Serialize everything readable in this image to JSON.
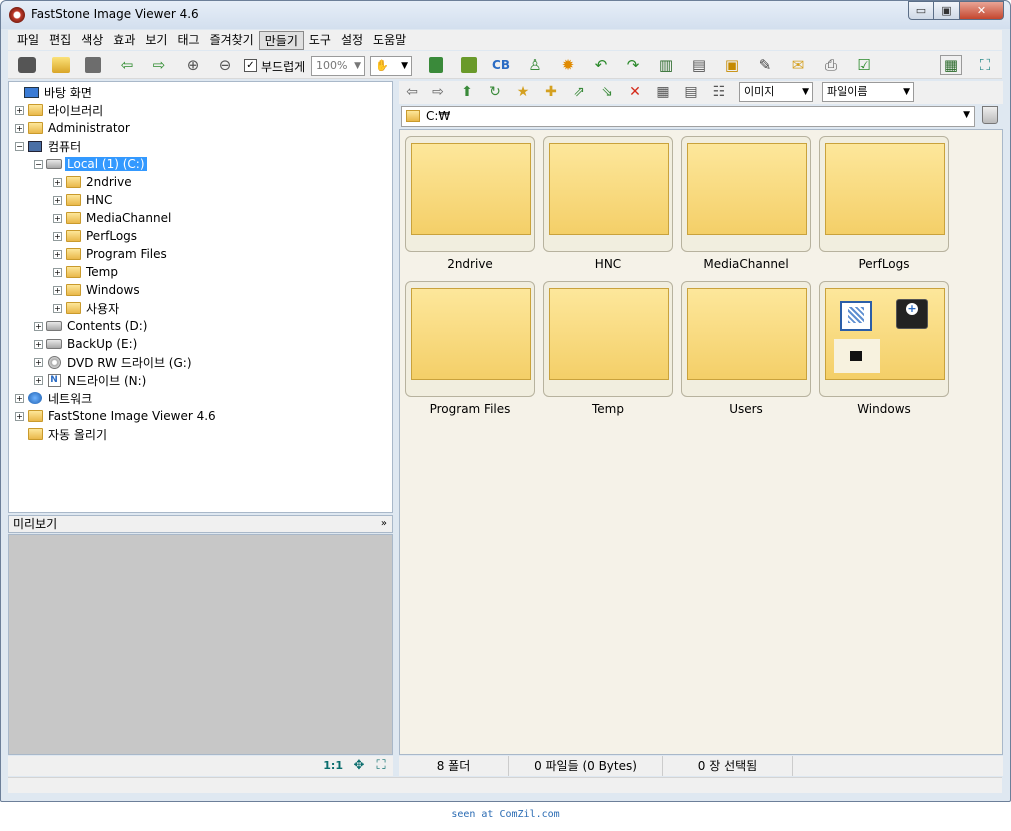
{
  "window": {
    "title": "FastStone Image Viewer 4.6",
    "min_glyph": "▭",
    "max_glyph": "▣",
    "close_glyph": "✕"
  },
  "menu": [
    {
      "label": "파일"
    },
    {
      "label": "편집"
    },
    {
      "label": "색상"
    },
    {
      "label": "효과"
    },
    {
      "label": "보기"
    },
    {
      "label": "태그"
    },
    {
      "label": "즐겨찾기"
    },
    {
      "label": "만들기"
    },
    {
      "label": "도구"
    },
    {
      "label": "설정"
    },
    {
      "label": "도움말"
    }
  ],
  "toolbar": {
    "smooth_label": "부드럽게",
    "smooth_checked": "✓",
    "zoom_value": "100%",
    "icons": [
      "camera-icon",
      "open-folder-icon",
      "save-icon",
      "prev-image-icon",
      "next-image-icon",
      "zoom-in-icon",
      "zoom-out-icon"
    ],
    "right_icons": [
      "resize-icon",
      "crop-icon",
      "color-balance-icon",
      "stamp-icon",
      "light-icon",
      "rotate-left-icon",
      "rotate-right-icon",
      "compare-icon",
      "slideshow-icon",
      "slideshow-builder-icon",
      "draw-icon",
      "email-icon",
      "print-icon",
      "check-icon",
      "layout-icon",
      "fullscreen-icon"
    ]
  },
  "tree": {
    "desktop": "바탕 화면",
    "library": "라이브러리",
    "admin": "Administrator",
    "computer": "컴퓨터",
    "drive_c": "Local (1) (C:)",
    "c_folders": [
      "2ndrive",
      "HNC",
      "MediaChannel",
      "PerfLogs",
      "Program Files",
      "Temp",
      "Windows",
      "사용자"
    ],
    "drive_d": "Contents (D:)",
    "drive_e": "BackUp (E:)",
    "drive_g": "DVD RW 드라이브 (G:)",
    "drive_n": "N드라이브 (N:)",
    "network": "네트워크",
    "fsiv": "FastStone Image Viewer 4.6",
    "autoupload": "자동 올리기"
  },
  "preview": {
    "title": "미리보기",
    "collapse": "»",
    "ratio": "1:1"
  },
  "browser_toolbar": {
    "filter_value": "이미지",
    "sort_value": "파일이름"
  },
  "address": {
    "path": "C:₩"
  },
  "thumbs": [
    {
      "label": "2ndrive"
    },
    {
      "label": "HNC"
    },
    {
      "label": "MediaChannel"
    },
    {
      "label": "PerfLogs"
    },
    {
      "label": "Program Files"
    },
    {
      "label": "Temp"
    },
    {
      "label": "Users"
    },
    {
      "label": "Windows"
    }
  ],
  "status": {
    "folders": "8 폴더",
    "files": "0 파일들 (0 Bytes)",
    "selected": "0 장 선택됨"
  },
  "watermark": "seen at ComZil.com"
}
